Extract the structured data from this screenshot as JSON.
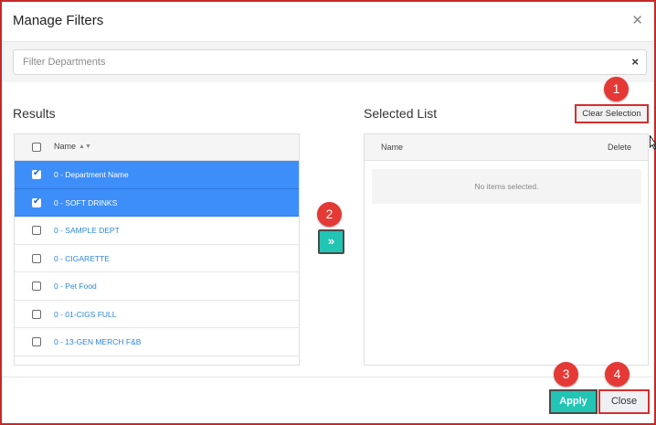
{
  "dialog": {
    "title": "Manage Filters"
  },
  "filter": {
    "placeholder": "Filter Departments",
    "clear_glyph": "×"
  },
  "results": {
    "title": "Results",
    "column_name": "Name",
    "items": [
      {
        "label": "0 - Department Name",
        "checked": true
      },
      {
        "label": "0 - SOFT DRINKS",
        "checked": true
      },
      {
        "label": "0 - SAMPLE DEPT",
        "checked": false
      },
      {
        "label": "0 - CIGARETTE",
        "checked": false
      },
      {
        "label": "0 - Pet Food",
        "checked": false
      },
      {
        "label": "0 - 01-CIGS FULL",
        "checked": false
      },
      {
        "label": "0 - 13-GEN MERCH F&B",
        "checked": false
      }
    ]
  },
  "move_button": {
    "glyph": "»"
  },
  "selected_list": {
    "title": "Selected List",
    "clear_label": "Clear Selection",
    "column_name": "Name",
    "column_delete": "Delete",
    "empty_message": "No items selected."
  },
  "footer": {
    "apply_label": "Apply",
    "close_label": "Close"
  },
  "annotations": [
    "1",
    "2",
    "3",
    "4"
  ],
  "colors": {
    "accent": "#22c4b3",
    "selected_row": "#3d8ef8",
    "annotation": "#e53935",
    "link": "#2f86d9"
  }
}
